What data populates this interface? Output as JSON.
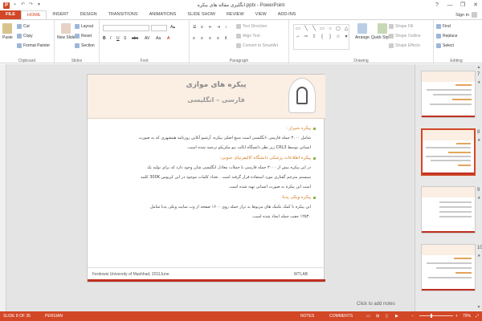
{
  "window": {
    "title": "انگلیزی مقاله های بیکره.pptx - PowerPoint",
    "sign_in": "Sign in",
    "controls": [
      "?",
      "—",
      "❐",
      "✕"
    ]
  },
  "qat": {
    "save_icon": "save-icon",
    "undo_icon": "undo-icon",
    "redo_icon": "redo-icon"
  },
  "tabs": [
    "FILE",
    "HOME",
    "INSERT",
    "DESIGN",
    "TRANSITIONS",
    "ANIMATIONS",
    "SLIDE SHOW",
    "REVIEW",
    "VIEW",
    "ADD-INS"
  ],
  "active_tab": "HOME",
  "ribbon": {
    "clipboard": {
      "label": "Clipboard",
      "paste": "Paste",
      "cut": "Cut",
      "copy": "Copy",
      "format_painter": "Format Painter"
    },
    "slides": {
      "label": "Slides",
      "new_slide": "New Slide",
      "layout": "Layout",
      "reset": "Reset",
      "section": "Section"
    },
    "font": {
      "label": "Font"
    },
    "paragraph": {
      "label": "Paragraph",
      "text_direction": "Text Direction",
      "align_text": "Align Text",
      "convert_smartart": "Convert to SmartArt"
    },
    "drawing": {
      "label": "Drawing",
      "arrange": "Arrange",
      "quick_styles": "Quick Styles",
      "shape_fill": "Shape Fill",
      "shape_outline": "Shape Outline",
      "shape_effects": "Shape Effects"
    },
    "editing": {
      "label": "Editing",
      "find": "Find",
      "replace": "Replace",
      "select": "Select"
    }
  },
  "slide": {
    "title": "پیکره های موازی",
    "subtitle": "فارسی – انگلیسی",
    "sections": [
      {
        "heading": "پیکره شیراز :",
        "lines": [
          "شامل ۳۰۰۰ جمله فارسی -انگلیسی است منبع اصلی پیکره، آرشیو آنلاین روزنامه همشهری که به صورت",
          "انسانی توسط CRL3 زیر نظر دانشگاه ایالت نیو مکزیکو ترجمه شده است."
        ]
      },
      {
        "heading": "پیکره اطلاعات پزشکی دانشگاه کالیفرنیای جنوبی:",
        "lines": [
          "در این پیکره بیش از ۳۰۰۰ جمله فارسی با جملات معادل انگلیسی شان وجود دارد که برای تولید یک",
          "سیستم مترجم گفتاری مورد استفاده قرار گرفته است . تعداد کلمات موجود در این کرپوس 300K کلمه",
          "است این پیکره به صورت انسانی تهیه شده است."
        ]
      },
      {
        "heading": "پیکره ویکی پدیا:",
        "lines": [
          "این پیکره با کمک تکنیک های مربوط به تراز جمله روی ۱۶۰۰ صفحه از وب سایت ویکی پدیا شامل",
          "۱۲۵۳۰ جفت جمله ایجاد شده است."
        ]
      }
    ],
    "footer_left": "Ferdowsi University of Mashhad, 2011June",
    "footer_right": "WTLAB"
  },
  "notes_placeholder": "Click to add notes",
  "thumbnails": [
    {
      "number": "7",
      "star": "★"
    },
    {
      "number": "8",
      "star": "★"
    },
    {
      "number": "9",
      "star": "★"
    },
    {
      "number": "10",
      "star": "★"
    }
  ],
  "selected_thumbnail": "8",
  "status": {
    "slide_info": "SLIDE 8 OF 35",
    "language": "PERSIAN",
    "notes": "NOTES",
    "comments": "COMMENTS",
    "zoom": "70%",
    "zoom_fraction": 0.7
  },
  "colors": {
    "accent": "#d24726",
    "slide_band": "#fbeee3",
    "heading": "#d47a1f",
    "bullet": "#8cb64a"
  }
}
